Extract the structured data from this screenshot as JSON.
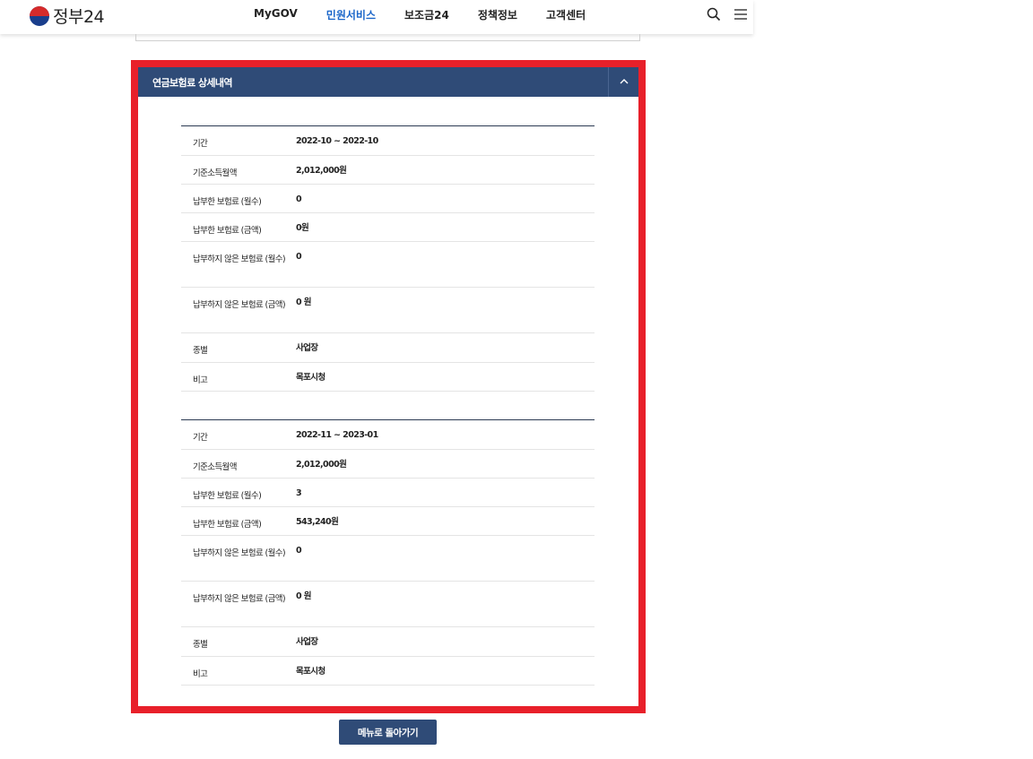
{
  "header": {
    "logo_text": "정부24",
    "nav": [
      "MyGOV",
      "민원서비스",
      "보조금24",
      "정책정보",
      "고객센터"
    ],
    "active_nav": "민원서비스",
    "icons": [
      "search-icon",
      "menu-icon"
    ]
  },
  "accordion": {
    "title": "연금보험료 상세내역",
    "toggle_icon": "chevron-up-icon"
  },
  "records": [
    {
      "rows": [
        {
          "label": "기간",
          "value": "2022-10 ~ 2022-10"
        },
        {
          "label": "기준소득월액",
          "value": "2,012,000원"
        },
        {
          "label": "납부한 보험료 (월수)",
          "value": "0"
        },
        {
          "label": "납부한 보험료 (금액)",
          "value": "0원"
        },
        {
          "label": "납부하지 않은 보험료 (월수)",
          "value": "0"
        },
        {
          "label": "납부하지 않은 보험료 (금액)",
          "value": "0 원"
        },
        {
          "label": "종별",
          "value": "사업장"
        },
        {
          "label": "비고",
          "value": "목포시청"
        }
      ]
    },
    {
      "rows": [
        {
          "label": "기간",
          "value": "2022-11 ~ 2023-01"
        },
        {
          "label": "기준소득월액",
          "value": "2,012,000원"
        },
        {
          "label": "납부한 보험료 (월수)",
          "value": "3"
        },
        {
          "label": "납부한 보험료 (금액)",
          "value": "543,240원"
        },
        {
          "label": "납부하지 않은 보험료 (월수)",
          "value": "0"
        },
        {
          "label": "납부하지 않은 보험료 (금액)",
          "value": "0 원"
        },
        {
          "label": "종별",
          "value": "사업장"
        },
        {
          "label": "비고",
          "value": "목포시청"
        }
      ]
    }
  ],
  "back_button": "메뉴로 돌아가기",
  "colors": {
    "header_accent": "#1b66c9",
    "accordion_head": "#2f4b77",
    "highlight": "#e8202a"
  }
}
